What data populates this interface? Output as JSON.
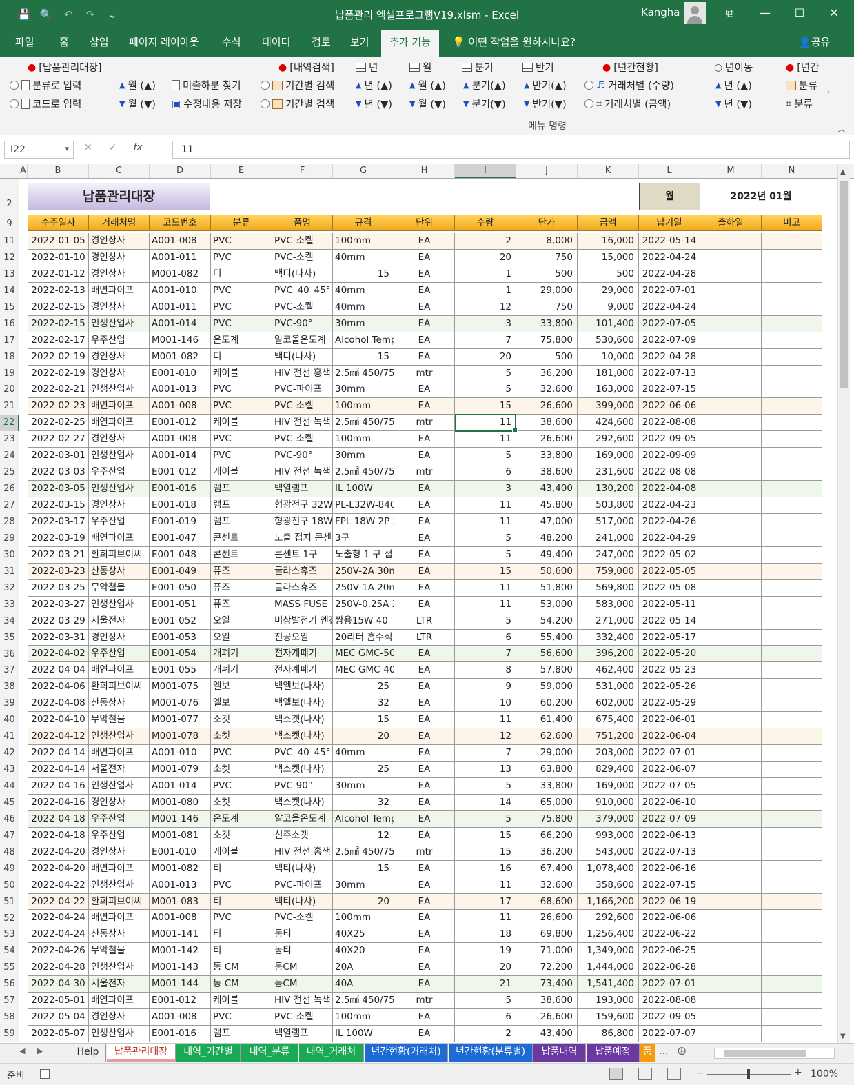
{
  "window": {
    "title": "납품관리 엑셀프로그램V19.xlsm  -  Excel",
    "user": "Kangha"
  },
  "ribbon_tabs": [
    "파일",
    "홈",
    "삽입",
    "페이지 레이아웃",
    "수식",
    "데이터",
    "검토",
    "보기",
    "추가 기능"
  ],
  "active_tab": "추가 기능",
  "tell_me": "어떤 작업을 원하시나요?",
  "share": "공유",
  "ribbon": {
    "btn_ledger": "[납품관리대장]",
    "btn_by_category": "분류로 입력",
    "btn_by_code": "코드로 입력",
    "btn_month_up": "월 (▲)",
    "btn_month_down": "월 (▼)",
    "btn_unshipped": "미출하분 찾기",
    "btn_save_edits": "수정내용 저장",
    "btn_history": "[내역검색]",
    "btn_period1": "기간별 검색",
    "btn_period2": "기간별 검색",
    "lbl_year": "년",
    "lbl_month": "월",
    "lbl_quarter": "분기",
    "lbl_half": "반기",
    "year_up": "년 (▲)",
    "year_down": "년 (▼)",
    "month_up": "월 (▲)",
    "month_down": "월 (▼)",
    "quarter_up": "분기(▲)",
    "quarter_down": "분기(▼)",
    "half_up": "반기(▲)",
    "half_down": "반기(▼)",
    "btn_annual": "[년간현황]",
    "by_client_qty": "거래처별 (수량)",
    "by_client_amt": "거래처별 (금액)",
    "btn_year_move": "년이동",
    "yr_up": "년 (▲)",
    "yr_down": "년 (▼)",
    "btn_annual2": "[년간",
    "cat1": "분류",
    "cat2": "분류",
    "cat3": "분류",
    "group_label": "메뉴 명령"
  },
  "formula_bar": {
    "name_box": "I22",
    "value": "11"
  },
  "columns": [
    "A",
    "B",
    "C",
    "D",
    "E",
    "F",
    "G",
    "H",
    "I",
    "J",
    "K",
    "L",
    "M",
    "N"
  ],
  "sheet": {
    "title": "납품관리대장",
    "month_label": "월",
    "month_value": "2022년 01월",
    "headers": [
      "수주일자",
      "거래처명",
      "코드번호",
      "분류",
      "품명",
      "규격",
      "단위",
      "수량",
      "단가",
      "금액",
      "납기일",
      "출하일",
      "비고"
    ],
    "row_numbers": [
      2,
      9,
      11
    ],
    "rows": [
      [
        "2022-01-05",
        "경인상사",
        "A001-008",
        "PVC",
        "PVC-소켈",
        "100mm",
        "EA",
        "2",
        "8,000",
        "16,000",
        "2022-05-14",
        "",
        ""
      ],
      [
        "2022-01-10",
        "경인상사",
        "A001-011",
        "PVC",
        "PVC-소켈",
        "40mm",
        "EA",
        "20",
        "750",
        "15,000",
        "2022-04-24",
        "",
        ""
      ],
      [
        "2022-01-12",
        "경인상사",
        "M001-082",
        "티",
        "백티(나사)",
        "15",
        "EA",
        "1",
        "500",
        "500",
        "2022-04-28",
        "",
        ""
      ],
      [
        "2022-02-13",
        "배연파이프",
        "A001-010",
        "PVC",
        "PVC_40_45°",
        "40mm",
        "EA",
        "1",
        "29,000",
        "29,000",
        "2022-07-01",
        "",
        ""
      ],
      [
        "2022-02-15",
        "경인상사",
        "A001-011",
        "PVC",
        "PVC-소켈",
        "40mm",
        "EA",
        "12",
        "750",
        "9,000",
        "2022-04-24",
        "",
        ""
      ],
      [
        "2022-02-15",
        "인생산업사",
        "A001-014",
        "PVC",
        "PVC-90°",
        "30mm",
        "EA",
        "3",
        "33,800",
        "101,400",
        "2022-07-05",
        "",
        ""
      ],
      [
        "2022-02-17",
        "우주산업",
        "M001-146",
        "온도계",
        "알코올온도계",
        "Alcohol Temp",
        "EA",
        "7",
        "75,800",
        "530,600",
        "2022-07-09",
        "",
        ""
      ],
      [
        "2022-02-19",
        "경인상사",
        "M001-082",
        "티",
        "백티(나사)",
        "15",
        "EA",
        "20",
        "500",
        "10,000",
        "2022-04-28",
        "",
        ""
      ],
      [
        "2022-02-19",
        "경인상사",
        "E001-010",
        "케이블",
        "HIV  전선 홍색",
        "2.5㎟ 450/750V",
        "mtr",
        "5",
        "36,200",
        "181,000",
        "2022-07-13",
        "",
        ""
      ],
      [
        "2022-02-21",
        "인생산업사",
        "A001-013",
        "PVC",
        "PVC-파이프",
        "30mm",
        "EA",
        "5",
        "32,600",
        "163,000",
        "2022-07-15",
        "",
        ""
      ],
      [
        "2022-02-23",
        "배연파이프",
        "A001-008",
        "PVC",
        "PVC-소켈",
        "100mm",
        "EA",
        "15",
        "26,600",
        "399,000",
        "2022-06-06",
        "",
        ""
      ],
      [
        "2022-02-25",
        "배연파이프",
        "E001-012",
        "케이블",
        "HIV  전선 녹색",
        "2.5㎟ 450/750V",
        "mtr",
        "11",
        "38,600",
        "424,600",
        "2022-08-08",
        "",
        ""
      ],
      [
        "2022-02-27",
        "경인상사",
        "A001-008",
        "PVC",
        "PVC-소켈",
        "100mm",
        "EA",
        "11",
        "26,600",
        "292,600",
        "2022-09-05",
        "",
        ""
      ],
      [
        "2022-03-01",
        "인생산업사",
        "A001-014",
        "PVC",
        "PVC-90°",
        "30mm",
        "EA",
        "5",
        "33,800",
        "169,000",
        "2022-09-09",
        "",
        ""
      ],
      [
        "2022-03-03",
        "우주산업",
        "E001-012",
        "케이블",
        "HIV  전선 녹색",
        "2.5㎟ 450/750V",
        "mtr",
        "6",
        "38,600",
        "231,600",
        "2022-08-08",
        "",
        ""
      ],
      [
        "2022-03-05",
        "인생산업사",
        "E001-016",
        "램프",
        "백열램프",
        "IL 100W",
        "EA",
        "3",
        "43,400",
        "130,200",
        "2022-04-08",
        "",
        ""
      ],
      [
        "2022-03-15",
        "경인상사",
        "E001-018",
        "램프",
        "형광전구 32W",
        "PL-L32W-840-4",
        "EA",
        "11",
        "45,800",
        "503,800",
        "2022-04-23",
        "",
        ""
      ],
      [
        "2022-03-17",
        "우주산업",
        "E001-019",
        "램프",
        "형광전구 18W",
        "FPL 18W 2P 3파",
        "EA",
        "11",
        "47,000",
        "517,000",
        "2022-04-26",
        "",
        ""
      ],
      [
        "2022-03-19",
        "배연파이프",
        "E001-047",
        "콘센트",
        "노출 접지 콘센",
        "3구",
        "EA",
        "5",
        "48,200",
        "241,000",
        "2022-04-29",
        "",
        ""
      ],
      [
        "2022-03-21",
        "환희피브이씨",
        "E001-048",
        "콘센트",
        "콘센트 1구",
        "노출형 1 구 접",
        "EA",
        "5",
        "49,400",
        "247,000",
        "2022-05-02",
        "",
        ""
      ],
      [
        "2022-03-23",
        "산동상사",
        "E001-049",
        "퓨즈",
        "글라스휴즈",
        "250V-2A 30mm",
        "EA",
        "15",
        "50,600",
        "759,000",
        "2022-05-05",
        "",
        ""
      ],
      [
        "2022-03-25",
        "무악철물",
        "E001-050",
        "퓨즈",
        "글라스휴즈",
        "250V-1A  20mm",
        "EA",
        "11",
        "51,800",
        "569,800",
        "2022-05-08",
        "",
        ""
      ],
      [
        "2022-03-27",
        "인생산업사",
        "E001-051",
        "퓨즈",
        "MASS FUSE",
        "250V-0.25A  20",
        "EA",
        "11",
        "53,000",
        "583,000",
        "2022-05-11",
        "",
        ""
      ],
      [
        "2022-03-29",
        "서울전자",
        "E001-052",
        "오일",
        "비상발전기 엔진",
        "쌍용15W 40",
        "LTR",
        "5",
        "54,200",
        "271,000",
        "2022-05-14",
        "",
        ""
      ],
      [
        "2022-03-31",
        "경인상사",
        "E001-053",
        "오일",
        "진공오일",
        "20리터 흡수식",
        "LTR",
        "6",
        "55,400",
        "332,400",
        "2022-05-17",
        "",
        ""
      ],
      [
        "2022-04-02",
        "우주산업",
        "E001-054",
        "개폐기",
        "전자계폐기",
        "MEC GMC-50",
        "EA",
        "7",
        "56,600",
        "396,200",
        "2022-05-20",
        "",
        ""
      ],
      [
        "2022-04-04",
        "배연파이프",
        "E001-055",
        "개폐기",
        "전자계폐기",
        "MEC GMC-40",
        "EA",
        "8",
        "57,800",
        "462,400",
        "2022-05-23",
        "",
        ""
      ],
      [
        "2022-04-06",
        "환희피브이씨",
        "M001-075",
        "엘보",
        "백엘보(나사)",
        "25",
        "EA",
        "9",
        "59,000",
        "531,000",
        "2022-05-26",
        "",
        ""
      ],
      [
        "2022-04-08",
        "산동상사",
        "M001-076",
        "엘보",
        "백엘보(나사)",
        "32",
        "EA",
        "10",
        "60,200",
        "602,000",
        "2022-05-29",
        "",
        ""
      ],
      [
        "2022-04-10",
        "무악철물",
        "M001-077",
        "소켓",
        "백소켓(나사)",
        "15",
        "EA",
        "11",
        "61,400",
        "675,400",
        "2022-06-01",
        "",
        ""
      ],
      [
        "2022-04-12",
        "인생산업사",
        "M001-078",
        "소켓",
        "백소켓(나사)",
        "20",
        "EA",
        "12",
        "62,600",
        "751,200",
        "2022-06-04",
        "",
        ""
      ],
      [
        "2022-04-14",
        "배연파이프",
        "A001-010",
        "PVC",
        "PVC_40_45°",
        "40mm",
        "EA",
        "7",
        "29,000",
        "203,000",
        "2022-07-01",
        "",
        ""
      ],
      [
        "2022-04-14",
        "서울전자",
        "M001-079",
        "소켓",
        "백소켓(나사)",
        "25",
        "EA",
        "13",
        "63,800",
        "829,400",
        "2022-06-07",
        "",
        ""
      ],
      [
        "2022-04-16",
        "인생산업사",
        "A001-014",
        "PVC",
        "PVC-90°",
        "30mm",
        "EA",
        "5",
        "33,800",
        "169,000",
        "2022-07-05",
        "",
        ""
      ],
      [
        "2022-04-16",
        "경인상사",
        "M001-080",
        "소켓",
        "백소켓(나사)",
        "32",
        "EA",
        "14",
        "65,000",
        "910,000",
        "2022-06-10",
        "",
        ""
      ],
      [
        "2022-04-18",
        "우주산업",
        "M001-146",
        "온도계",
        "알코올온도계",
        "Alcohol Temp",
        "EA",
        "5",
        "75,800",
        "379,000",
        "2022-07-09",
        "",
        ""
      ],
      [
        "2022-04-18",
        "우주산업",
        "M001-081",
        "소켓",
        "신주소켓",
        "12",
        "EA",
        "15",
        "66,200",
        "993,000",
        "2022-06-13",
        "",
        ""
      ],
      [
        "2022-04-20",
        "경인상사",
        "E001-010",
        "케이블",
        "HIV  전선 홍색",
        "2.5㎟ 450/750V",
        "mtr",
        "15",
        "36,200",
        "543,000",
        "2022-07-13",
        "",
        ""
      ],
      [
        "2022-04-20",
        "배연파이프",
        "M001-082",
        "티",
        "백티(나사)",
        "15",
        "EA",
        "16",
        "67,400",
        "1,078,400",
        "2022-06-16",
        "",
        ""
      ],
      [
        "2022-04-22",
        "인생산업사",
        "A001-013",
        "PVC",
        "PVC-파이프",
        "30mm",
        "EA",
        "11",
        "32,600",
        "358,600",
        "2022-07-15",
        "",
        ""
      ],
      [
        "2022-04-22",
        "환희피브이씨",
        "M001-083",
        "티",
        "백티(나사)",
        "20",
        "EA",
        "17",
        "68,600",
        "1,166,200",
        "2022-06-19",
        "",
        ""
      ],
      [
        "2022-04-24",
        "배연파이프",
        "A001-008",
        "PVC",
        "PVC-소켈",
        "100mm",
        "EA",
        "11",
        "26,600",
        "292,600",
        "2022-06-06",
        "",
        ""
      ],
      [
        "2022-04-24",
        "산동상사",
        "M001-141",
        "티",
        "동티",
        "40X25",
        "EA",
        "18",
        "69,800",
        "1,256,400",
        "2022-06-22",
        "",
        ""
      ],
      [
        "2022-04-26",
        "무악철물",
        "M001-142",
        "티",
        "동티",
        "40X20",
        "EA",
        "19",
        "71,000",
        "1,349,000",
        "2022-06-25",
        "",
        ""
      ],
      [
        "2022-04-28",
        "인생산업사",
        "M001-143",
        "동 CM",
        "동CM",
        "20A",
        "EA",
        "20",
        "72,200",
        "1,444,000",
        "2022-06-28",
        "",
        ""
      ],
      [
        "2022-04-30",
        "서울전자",
        "M001-144",
        "동 CM",
        "동CM",
        "40A",
        "EA",
        "21",
        "73,400",
        "1,541,400",
        "2022-07-01",
        "",
        ""
      ],
      [
        "2022-05-01",
        "배연파이프",
        "E001-012",
        "케이블",
        "HIV  전선 녹색",
        "2.5㎟ 450/750V",
        "mtr",
        "5",
        "38,600",
        "193,000",
        "2022-08-08",
        "",
        ""
      ],
      [
        "2022-05-04",
        "경인상사",
        "A001-008",
        "PVC",
        "PVC-소켈",
        "100mm",
        "EA",
        "6",
        "26,600",
        "159,600",
        "2022-09-05",
        "",
        ""
      ],
      [
        "2022-05-07",
        "인생산업사",
        "E001-016",
        "램프",
        "백열램프",
        "IL 100W",
        "EA",
        "2",
        "43,400",
        "86,800",
        "2022-07-07",
        "",
        ""
      ]
    ]
  },
  "sheet_tabs": [
    "Help",
    "납품관리대장",
    "내역_기간별",
    "내역_분류",
    "내역_거래처",
    "년간현황(거래처)",
    "년간현황(분류별)",
    "납품내역",
    "납품예정",
    "품"
  ],
  "active_sheet": "납품관리대장",
  "sheet_tab_more": "...",
  "status": {
    "ready": "준비",
    "zoom": "100%"
  }
}
